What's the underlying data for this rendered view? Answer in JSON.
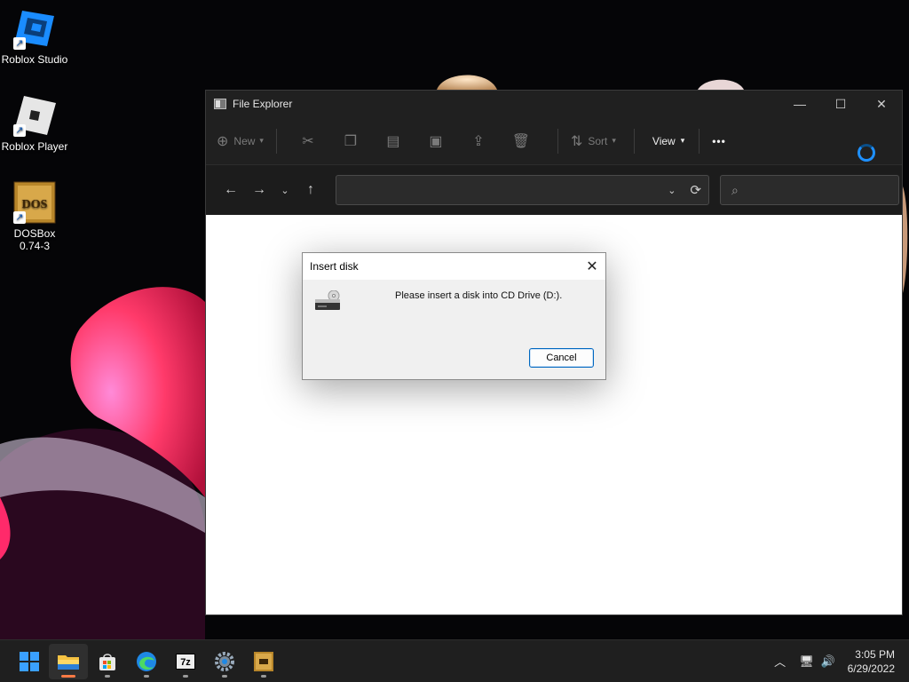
{
  "desktop": {
    "icons": [
      {
        "label": "Roblox Studio"
      },
      {
        "label": "Roblox Player"
      },
      {
        "label": "DOSBox\n0.74-3"
      }
    ],
    "dosbox_logo_text": "DOS"
  },
  "explorer": {
    "title": "File Explorer",
    "caption": {
      "minimize": "—",
      "maximize": "☐",
      "close": "✕"
    },
    "commands": {
      "new_label": "New",
      "sort_label": "Sort",
      "view_label": "View",
      "more_label": "•••"
    },
    "address_value": "",
    "search_placeholder": ""
  },
  "dialog": {
    "title": "Insert disk",
    "message": "Please insert a disk into CD Drive (D:).",
    "cancel_label": "Cancel",
    "close_glyph": "✕"
  },
  "taskbar": {
    "apps": [
      "start",
      "file-explorer",
      "microsoft-store",
      "edge",
      "7-zip",
      "settings",
      "dosbox"
    ],
    "sevenzip_text": "7z",
    "time": "3:05 PM",
    "date": "6/29/2022"
  },
  "colors": {
    "accent": "#0067c0",
    "taskbar_active_indicator": "#ff7a45",
    "titlebar_bg": "#202020"
  }
}
